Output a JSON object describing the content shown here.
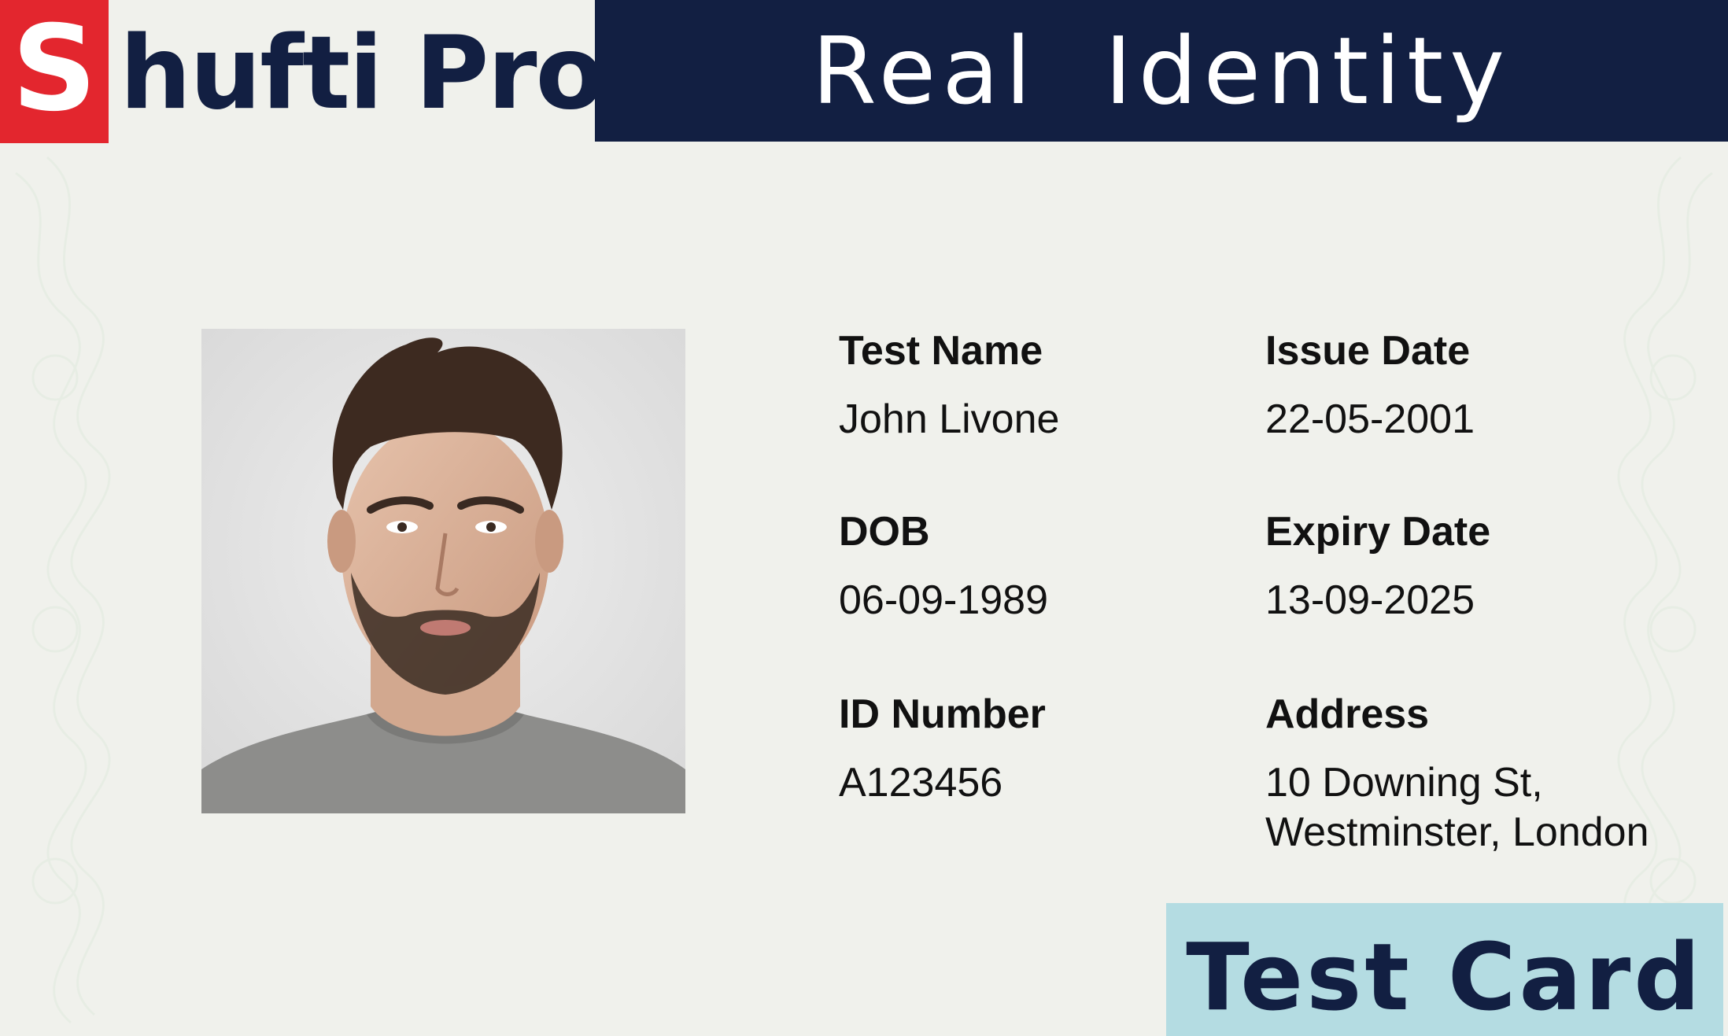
{
  "logo": {
    "badge_letter": "S",
    "text": "hufti Pro"
  },
  "header": {
    "title": "Real  Identity"
  },
  "photo": {
    "icon": "portrait-photo"
  },
  "fields": {
    "name": {
      "label": "Test Name",
      "value": "John Livone"
    },
    "issue_date": {
      "label": "Issue Date",
      "value": "22-05-2001"
    },
    "dob": {
      "label": "DOB",
      "value": "06-09-1989"
    },
    "expiry_date": {
      "label": "Expiry Date",
      "value": "13-09-2025"
    },
    "id_number": {
      "label": "ID Number",
      "value": "A123456"
    },
    "address": {
      "label": "Address",
      "value": "10 Downing St,\nWestminster, London"
    }
  },
  "footer": {
    "badge": "Test Card"
  },
  "colors": {
    "navy": "#121f42",
    "red": "#e3262e",
    "card_bg": "#f0f1ec",
    "badge_bg": "#b4dce2"
  }
}
